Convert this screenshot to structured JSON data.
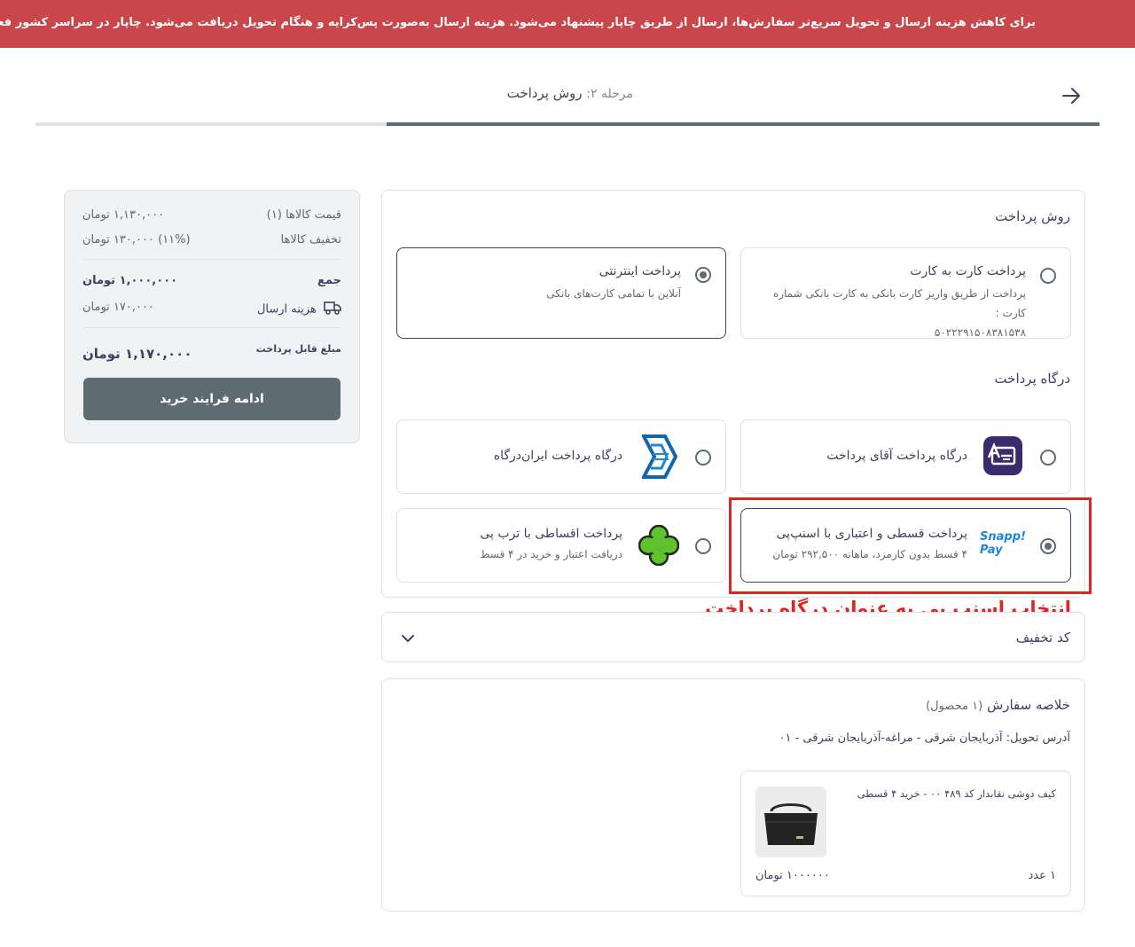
{
  "banner": {
    "text": "برای کاهش هزینه ارسال و تحویل سریع‌تر سفارش‌ها، ارسال از طریق چاپار پیشنهاد می‌شود. هزینه ارسال به‌صورت پس‌کرایه و هنگام تحویل دریافت می‌شود. چاپار در سراسر کشور فعال است."
  },
  "step": {
    "prefix": "مرحله ۲:",
    "title": "روش پرداخت",
    "progress_percent": 67
  },
  "payment_method": {
    "title": "روش پرداخت",
    "options": [
      {
        "title": "پرداخت کارت به کارت",
        "subtitle": "پرداخت از طریق واریز کارت بانکی به کارت بانکی شماره کارت :",
        "card_number": "۵۰۲۲۲۹۱۵۰۸۳۸۱۵۳۸",
        "selected": false
      },
      {
        "title": "پرداخت اینترنتی",
        "subtitle": "آنلاین با تمامی کارت‌های بانکی",
        "selected": true
      }
    ]
  },
  "gateway": {
    "title": "درگاه پرداخت",
    "options": [
      {
        "title": "درگاه پرداخت آقای پرداخت",
        "icon": "aqayepardakht-logo-icon",
        "selected": false
      },
      {
        "title": "درگاه پرداخت ایران‌درگاه",
        "icon": "irandargah-logo-icon",
        "selected": false
      },
      {
        "title": "پرداخت قسطی و اعتباری با اسنپ‌پی",
        "subtitle": "۴ قسط بدون کارمزد، ماهانه ۲۹۲,۵۰۰ تومان",
        "logo_text_1": "Snapp!",
        "logo_text_2": "Pay",
        "selected": true
      },
      {
        "title": "پرداخت اقساطی با ترب پی",
        "subtitle": "دریافت اعتبار و خرید در ۴ قسط",
        "icon": "torobpay-logo-icon",
        "selected": false
      }
    ]
  },
  "annotation": {
    "text": "انتخاب اسنپ پی به عنوان درگاه پرداخت",
    "color": "#e02323"
  },
  "discount": {
    "label": "کد تخفیف"
  },
  "order": {
    "title": "خلاصه سفارش",
    "count": "(۱ محصول)",
    "address": "آدرس تحویل: آذربایجان شرقی - مراغه-آذربایجان شرقی - ۰۱",
    "item": {
      "name": "کیف دوشی نقابدار کد ۴۸۹ ۰۰ - خرید ۴ قسطی",
      "quantity": "۱ عدد",
      "price": "۱۰۰۰۰۰۰ تومان"
    }
  },
  "summary": {
    "items_price_label": "قیمت کالاها (۱)",
    "items_price_value": "۱,۱۳۰,۰۰۰ تومان",
    "discount_label": "تخفیف کالاها",
    "discount_value": "(۱۱%) ۱۳۰,۰۰۰ تومان",
    "total_label": "جمع",
    "total_value": "۱,۰۰۰,۰۰۰ تومان",
    "shipping_label": "هزینه ارسال",
    "shipping_value": "۱۷۰,۰۰۰ تومان",
    "payable_label": "مبلغ قابل پرداخت",
    "payable_value": "۱,۱۷۰,۰۰۰ تومان",
    "button_label": "ادامه فرایند خرید"
  },
  "colors": {
    "banner": "#c9474b",
    "primary": "#5f6b73",
    "text": "#3f4064",
    "annotation": "#e02323"
  }
}
